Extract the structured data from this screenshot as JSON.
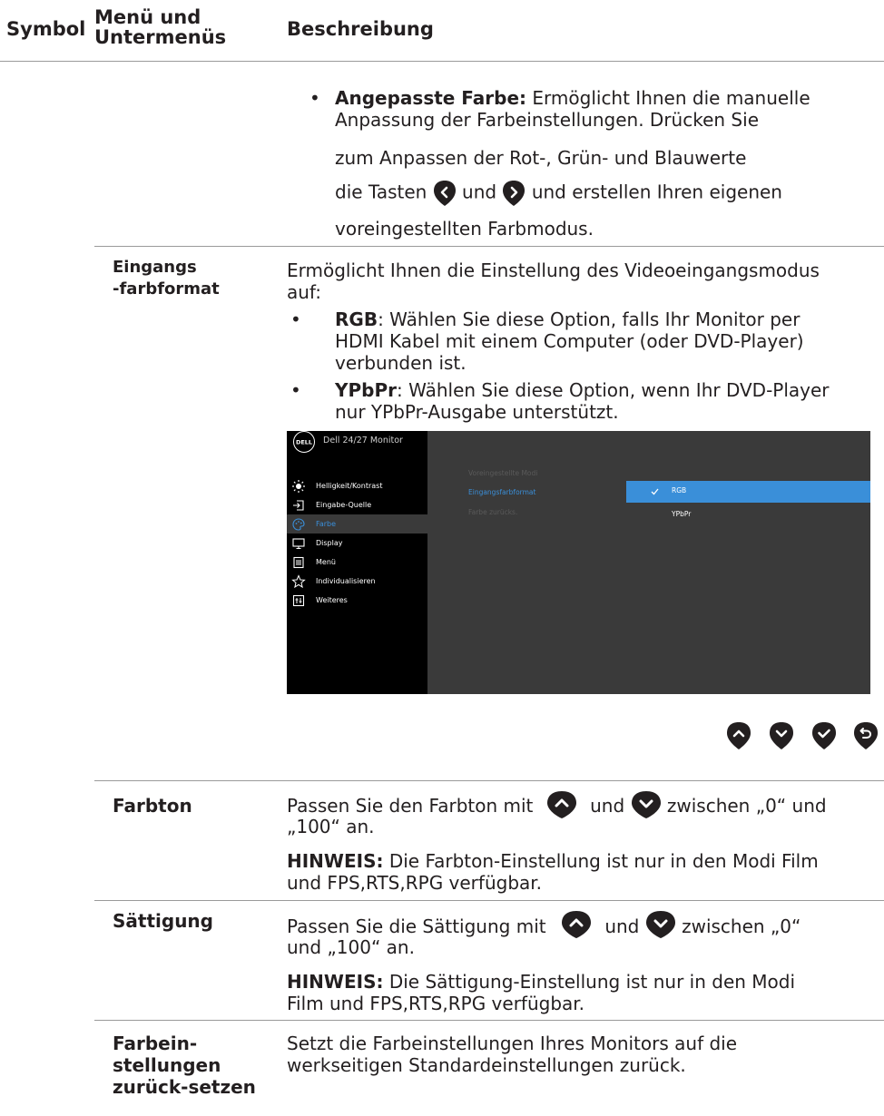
{
  "header": {
    "col_symbol": "Symbol",
    "col_menu": "Menü und Untermenüs",
    "col_desc": "Beschreibung"
  },
  "custom_color": {
    "bold": "Angepasste Farbe:",
    "line1_rest": " Ermöglicht Ihnen die manuelle",
    "line2": "Anpassung der Farbeinstellungen. Drücken Sie",
    "line3": "zum Anpassen der Rot-, Grün- und Blauwerte",
    "line4_a": "die Tasten",
    "line4_b": "und",
    "line4_c": "und erstellen Ihren eigenen",
    "line5": "voreingestellten Farbmodus."
  },
  "input_color": {
    "label_line1": "Eingangs",
    "label_line2": "-farbformat",
    "intro_line1": "Ermöglicht Ihnen die Einstellung des Videoeingangsmodus",
    "intro_line2": "auf:",
    "rgb_bold": "RGB",
    "rgb_line1": ": Wählen Sie diese Option, falls Ihr Monitor per",
    "rgb_line2": "HDMI Kabel mit einem Computer (oder DVD-Player)",
    "rgb_line3": "verbunden ist.",
    "ypbpr_bold": "YPbPr",
    "ypbpr_line1": ": Wählen Sie diese Option, wenn Ihr DVD-Player",
    "ypbpr_line2": "nur YPbPr-Ausgabe unterstützt."
  },
  "osd": {
    "logo": "DELL",
    "title": "Dell 24/27 Monitor",
    "menu": [
      {
        "label": "Helligkeit/Kontrast",
        "icon": "brightness-icon"
      },
      {
        "label": "Eingabe-Quelle",
        "icon": "input-source-icon"
      },
      {
        "label": "Farbe",
        "icon": "palette-icon"
      },
      {
        "label": "Display",
        "icon": "display-icon"
      },
      {
        "label": "Menü",
        "icon": "menu-icon"
      },
      {
        "label": "Individualisieren",
        "icon": "star-icon"
      },
      {
        "label": "Weiteres",
        "icon": "others-icon"
      }
    ],
    "submenu": [
      "Voreingestellte Modi",
      "Eingangsfarbformat",
      "Farbe zurücks."
    ],
    "options": [
      "RGB",
      "YPbPr"
    ],
    "selected_option": "RGB",
    "accent_color": "#3a8fd9"
  },
  "hue": {
    "label": "Farbton",
    "line1_a": "Passen Sie den Farbton mit",
    "line1_b": "und",
    "line1_c": "zwischen „0“ und",
    "line2": "„100“ an.",
    "note_bold": "HINWEIS:",
    "note_line1": " Die Farbton-Einstellung ist nur in den Modi Film",
    "note_line2": "und FPS,RTS,RPG verfügbar."
  },
  "saturation": {
    "label": "Sättigung",
    "line1_a": "Passen Sie die Sättigung mit",
    "line1_b": "und",
    "line1_c": "zwischen „0“",
    "line2": "und „100“ an.",
    "note_bold": "HINWEIS:",
    "note_line1": " Die Sättigung-Einstellung ist nur in den Modi",
    "note_line2": "Film und FPS,RTS,RPG verfügbar."
  },
  "reset": {
    "label_line1": "Farbein-",
    "label_line2": "stellungen",
    "label_line3": "zurück-setzen",
    "line1": "Setzt die Farbeinstellungen Ihres Monitors auf die",
    "line2": "werkseitigen Standardeinstellungen zurück."
  },
  "icons": {
    "btn_color": "#231f20",
    "left": "chevron-left-icon",
    "right": "chevron-right-icon",
    "up": "chevron-up-icon",
    "down": "chevron-down-icon",
    "check": "check-icon",
    "back": "back-icon"
  }
}
